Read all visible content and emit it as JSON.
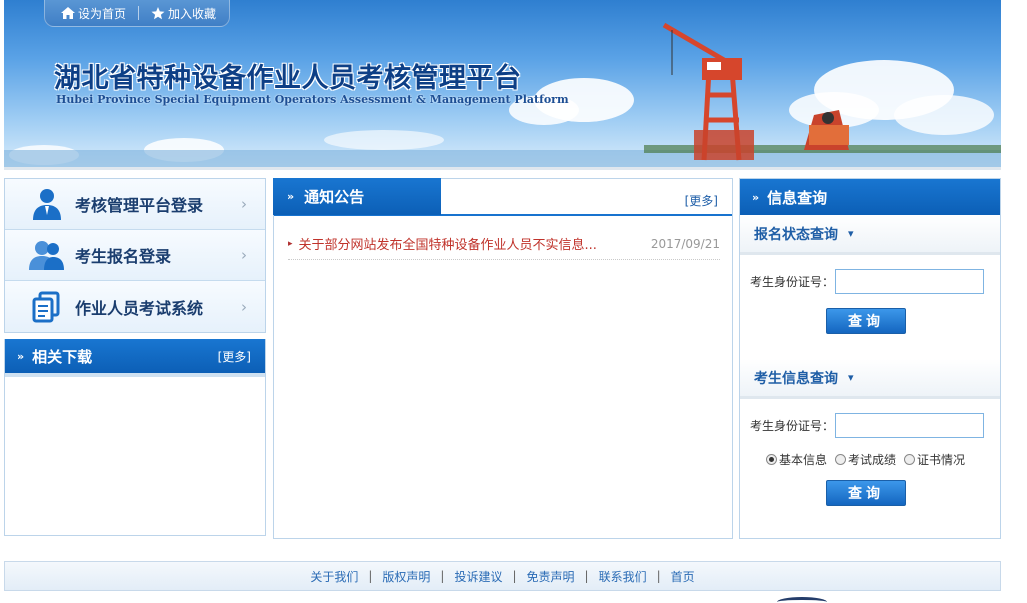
{
  "topbar": {
    "home_label": "设为首页",
    "favorite_label": "加入收藏"
  },
  "header": {
    "title": "湖北省特种设备作业人员考核管理平台",
    "subtitle": "Hubei Province Special Equipment Operators Assessment & Management Platform"
  },
  "sidebar": {
    "items": [
      {
        "label": "考核管理平台登录",
        "icon": "user-icon"
      },
      {
        "label": "考生报名登录",
        "icon": "users-icon"
      },
      {
        "label": "作业人员考试系统",
        "icon": "document-icon"
      }
    ],
    "downloads": {
      "title": "相关下载",
      "more": "[更多]"
    }
  },
  "notice": {
    "title": "通知公告",
    "more": "[更多]",
    "items": [
      {
        "title": "关于部分网站发布全国特种设备作业人员不实信息...",
        "date": "2017/09/21"
      }
    ]
  },
  "info": {
    "title": "信息查询",
    "registration": {
      "title": "报名状态查询",
      "id_label": "考生身份证号：",
      "id_value": "",
      "button": "查询"
    },
    "candidate": {
      "title": "考生信息查询",
      "id_label": "考生身份证号：",
      "id_value": "",
      "options": [
        "基本信息",
        "考试成绩",
        "证书情况"
      ],
      "selected": "基本信息",
      "button": "查询"
    }
  },
  "footer": {
    "links": [
      "关于我们",
      "版权声明",
      "投诉建议",
      "免责声明",
      "联系我们",
      "首页"
    ]
  },
  "colors": {
    "brand_blue": "#0c5fb6",
    "title_navy": "#0d3f86",
    "notice_red": "#c0332b",
    "link_blue": "#2a6bb5"
  }
}
